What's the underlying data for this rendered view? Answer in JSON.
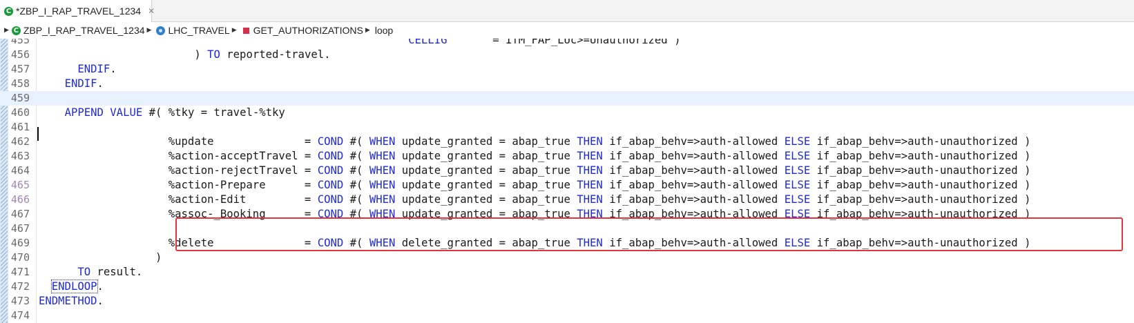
{
  "tab": {
    "title": "*ZBP_I_RAP_TRAVEL_1234",
    "close_symbol": "✕"
  },
  "breadcrumb": [
    {
      "label": "ZBP_I_RAP_TRAVEL_1234",
      "icon": "abap-class-icon"
    },
    {
      "label": "LHC_TRAVEL",
      "icon": "local-class-icon"
    },
    {
      "label": "GET_AUTHORIZATIONS",
      "icon": "method-icon"
    },
    {
      "label": "loop",
      "icon": ""
    }
  ],
  "editor": {
    "first_visible_line": 455,
    "current_line": 459,
    "highlighted_lines": [
      465,
      466
    ],
    "lines": [
      {
        "n": "455",
        "text": "                                                         CELLIG       = IfM_FAP_LUc>=Unauthorized )"
      },
      {
        "n": "456",
        "text": "                        ) TO reported-travel."
      },
      {
        "n": "457",
        "text": "      ENDIF."
      },
      {
        "n": "458",
        "text": "    ENDIF."
      },
      {
        "n": "459",
        "text": ""
      },
      {
        "n": "460",
        "text": "    APPEND VALUE #( %tky = travel-%tky"
      },
      {
        "n": "461",
        "text": ""
      },
      {
        "n": "462",
        "text": "                    %update              = COND #( WHEN update_granted = abap_true THEN if_abap_behv=>auth-allowed ELSE if_abap_behv=>auth-unauthorized )"
      },
      {
        "n": "463",
        "text": "                    %action-acceptTravel = COND #( WHEN update_granted = abap_true THEN if_abap_behv=>auth-allowed ELSE if_abap_behv=>auth-unauthorized )"
      },
      {
        "n": "464",
        "text": "                    %action-rejectTravel = COND #( WHEN update_granted = abap_true THEN if_abap_behv=>auth-allowed ELSE if_abap_behv=>auth-unauthorized )"
      },
      {
        "n": "465",
        "text": "                    %action-Prepare      = COND #( WHEN update_granted = abap_true THEN if_abap_behv=>auth-allowed ELSE if_abap_behv=>auth-unauthorized )"
      },
      {
        "n": "466",
        "text": "                    %action-Edit         = COND #( WHEN update_granted = abap_true THEN if_abap_behv=>auth-allowed ELSE if_abap_behv=>auth-unauthorized )"
      },
      {
        "n": "467",
        "text": "                    %assoc-_Booking      = COND #( WHEN update_granted = abap_true THEN if_abap_behv=>auth-allowed ELSE if_abap_behv=>auth-unauthorized )"
      },
      {
        "n": "467",
        "text": ""
      },
      {
        "n": "469",
        "text": "                    %delete              = COND #( WHEN delete_granted = abap_true THEN if_abap_behv=>auth-allowed ELSE if_abap_behv=>auth-unauthorized )"
      },
      {
        "n": "470",
        "text": "                  )"
      },
      {
        "n": "471",
        "text": "      TO result."
      },
      {
        "n": "472",
        "text": "  ENDLOOP."
      },
      {
        "n": "473",
        "text": "ENDMETHOD."
      },
      {
        "n": "474",
        "text": ""
      }
    ]
  },
  "keywords": [
    "APPEND",
    "VALUE",
    "COND",
    "WHEN",
    "THEN",
    "ELSE",
    "ENDIF",
    "ENDLOOP",
    "ENDMETHOD",
    "TO",
    "CELLIG"
  ],
  "colors": {
    "keyword": "#1f2bd8",
    "highlight_box": "#e0353a",
    "current_line": "#e8f2fe",
    "class_icon": "#1b9a3c",
    "method_icon": "#d62f4b"
  }
}
